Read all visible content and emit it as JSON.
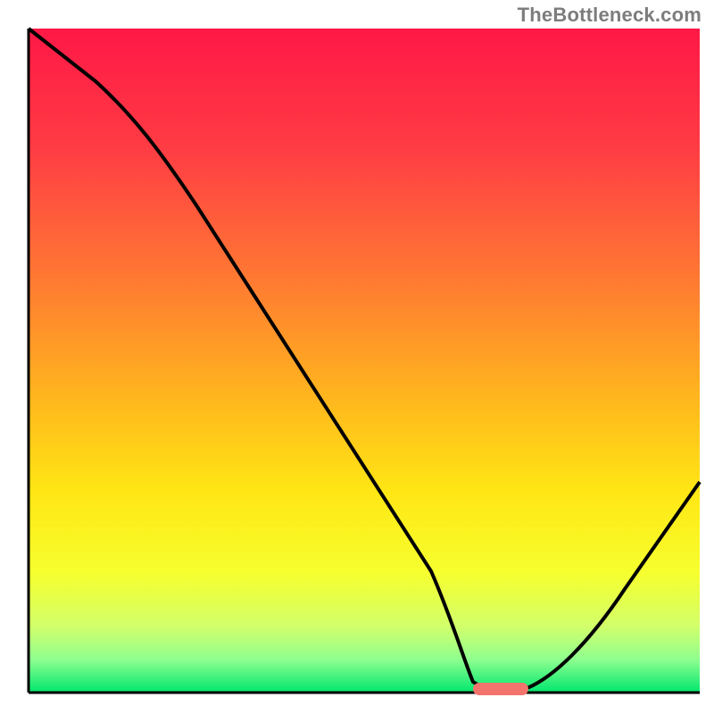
{
  "watermark": "TheBottleneck.com",
  "chart_data": {
    "type": "line",
    "title": "",
    "xlabel": "",
    "ylabel": "",
    "xlim": [
      0,
      100
    ],
    "ylim": [
      0,
      100
    ],
    "grid": false,
    "note": "No tick labels or axis values are rendered in the source image; x/y values are normalized 0-100 estimates read off pixel positions.",
    "series": [
      {
        "name": "bottleneck-curve",
        "x": [
          0,
          10,
          20,
          30,
          40,
          50,
          60,
          66,
          72,
          80,
          90,
          100
        ],
        "y": [
          100,
          92,
          80,
          65,
          49,
          34,
          18,
          4,
          0,
          4,
          16,
          32
        ]
      }
    ],
    "marker": {
      "name": "highlight-segment",
      "x_start": 66,
      "x_end": 74,
      "y": 0,
      "color": "#f3736d"
    },
    "background_gradient_stops": [
      {
        "offset": 0.0,
        "color": "#ff1846"
      },
      {
        "offset": 0.18,
        "color": "#ff3c44"
      },
      {
        "offset": 0.38,
        "color": "#ff7a32"
      },
      {
        "offset": 0.55,
        "color": "#ffb41e"
      },
      {
        "offset": 0.7,
        "color": "#ffe714"
      },
      {
        "offset": 0.82,
        "color": "#f6ff2f"
      },
      {
        "offset": 0.9,
        "color": "#d2ff6a"
      },
      {
        "offset": 0.95,
        "color": "#8fff8f"
      },
      {
        "offset": 1.0,
        "color": "#00e66f"
      }
    ]
  }
}
